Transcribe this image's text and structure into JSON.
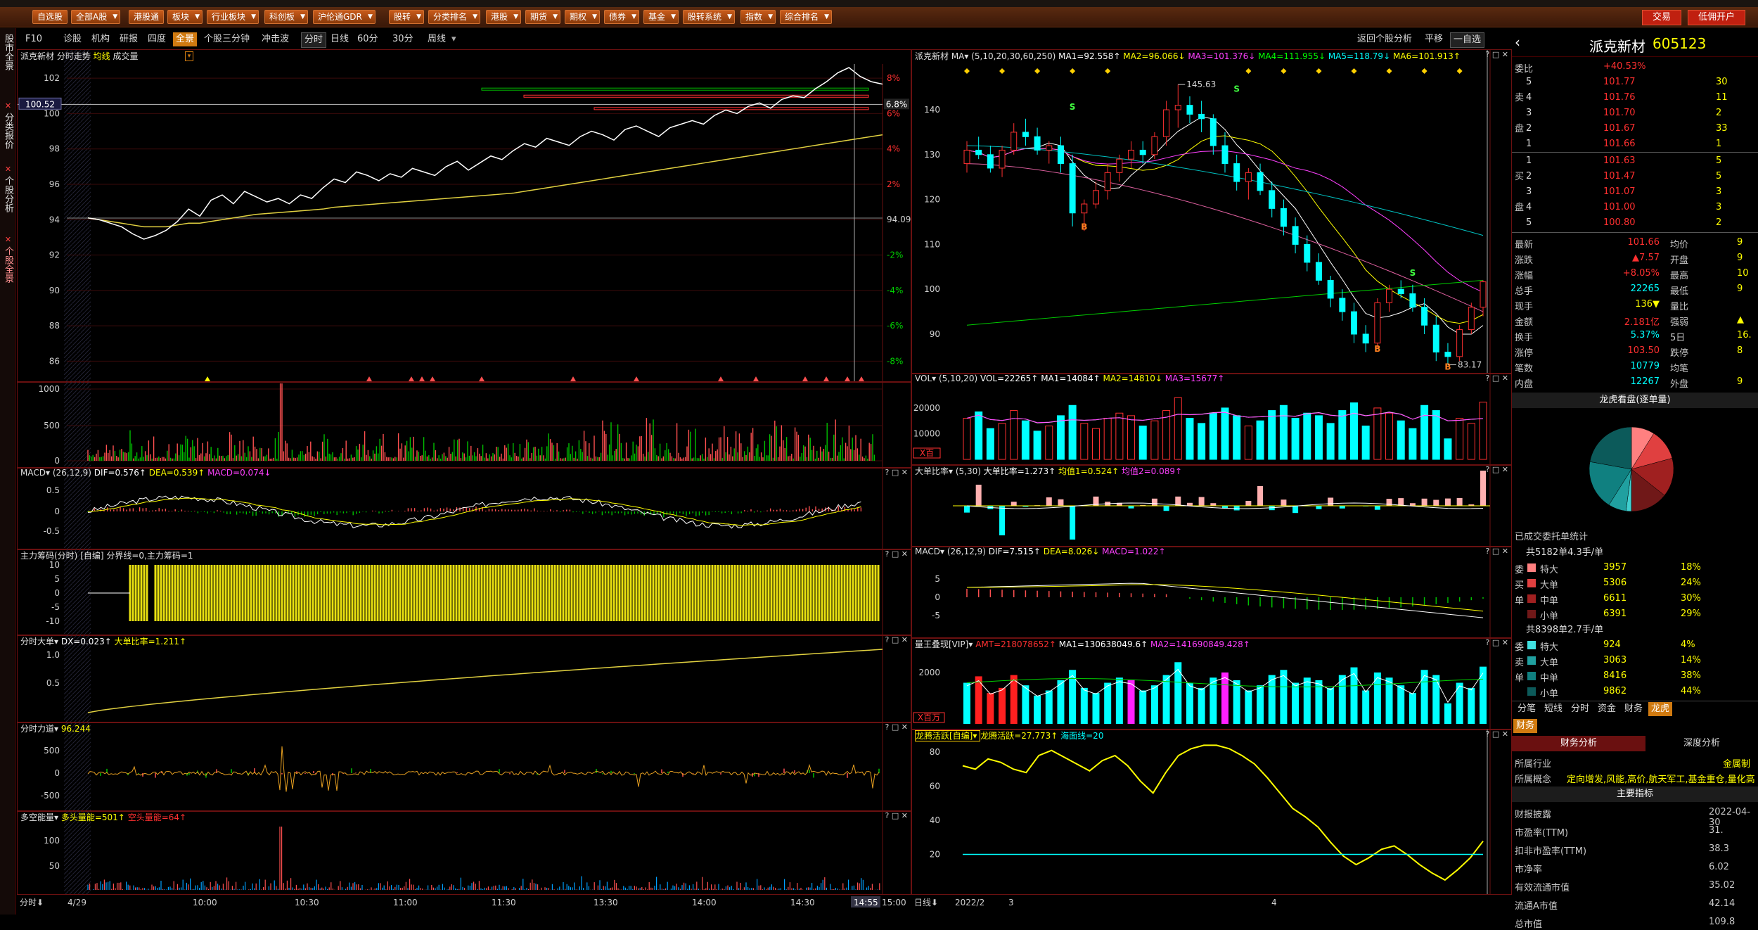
{
  "menubar": {
    "buttons": [
      "自选股",
      "全部A股",
      "港股通",
      "板块",
      "行业板块",
      "科创板",
      "沪伦通GDR",
      "股转",
      "分类排名",
      "港股",
      "期货",
      "期权",
      "债券",
      "基金",
      "股转系统",
      "指数",
      "综合排名"
    ],
    "right_buttons": [
      "交易",
      "低佣开户"
    ]
  },
  "leftrail": {
    "tabs": [
      "股市全景",
      "分类报价",
      "个股分析",
      "个股全景"
    ]
  },
  "tabbar": {
    "tabs": [
      "F10",
      "诊股",
      "机构",
      "研报",
      "四度",
      "全景",
      "个股三分钟",
      "冲击波"
    ],
    "periods": [
      "分时",
      "日线",
      "60分",
      "30分",
      "周线"
    ],
    "right_tabs": [
      "返回个股分析",
      "平移",
      "一自选"
    ]
  },
  "intraday": {
    "title_stock": "派克新材",
    "title_label": "分时走势",
    "title_avg": "均线",
    "title_vol": "成交量",
    "price_ticks": [
      "102",
      "100",
      "98",
      "96",
      "94",
      "92",
      "90",
      "88",
      "86"
    ],
    "pct_ticks": [
      "8%",
      "6%",
      "4%",
      "2%",
      "",
      "-2%",
      "-4%",
      "-6%",
      "-8%"
    ],
    "current_price_label": "100.52",
    "current_pct_label": "6.8%",
    "prev_close_label": "94.09",
    "time_labels": [
      "4/29",
      "10:00",
      "10:30",
      "11:00",
      "11:30",
      "13:30",
      "14:00",
      "14:30",
      "14:55",
      "15:00"
    ],
    "time_toggle": "分时",
    "vol_ticks": [
      "1000",
      "500",
      "0"
    ]
  },
  "macd1": {
    "name": "MACD",
    "params": "(26,12,9)",
    "dif": "DIF=0.576",
    "dea": "DEA=0.539",
    "macd": "MACD=0.074"
  },
  "chips": {
    "name": "主力筹码(分时)",
    "flag": "[自编]",
    "divider": "分界线=0,主力筹码=1",
    "ticks": [
      "10",
      "5",
      "0",
      "-5",
      "-10"
    ]
  },
  "bigorder": {
    "name": "分时大单",
    "dx": "DX=0.023",
    "ratio": "大单比率=1.211",
    "ticks": [
      "1.0",
      "0.5"
    ]
  },
  "force": {
    "name": "分时力道",
    "value": "96.244",
    "ticks": [
      "500",
      "0",
      "-500"
    ]
  },
  "bullbear": {
    "name": "多空能量",
    "bull": "多头量能=501",
    "bear": "空头量能=64",
    "ticks": [
      "100",
      "50"
    ]
  },
  "daily": {
    "stock": "派克新材",
    "ma_name": "MA",
    "ma_params": "(5,10,20,30,60,250)",
    "ma_values": [
      "MA1=92.558",
      "MA2=96.066",
      "MA3=101.376",
      "MA4=111.955",
      "MA5=118.79",
      "MA6=101.913"
    ],
    "price_ticks": [
      "140",
      "130",
      "120",
      "110",
      "100",
      "90"
    ],
    "high_label": "145.63",
    "low_label": "83.17",
    "time_labels": [
      "日线",
      "2022/2",
      "3",
      "4"
    ],
    "buy_marks": [
      "B",
      "B",
      "B"
    ],
    "sell_marks": [
      "S",
      "S",
      "S"
    ]
  },
  "vol": {
    "name": "VOL",
    "params": "(5,10,20)",
    "vol": "VOL=22265",
    "ma1": "MA1=14084",
    "ma2": "MA2=14810",
    "ma3": "MA3=15677",
    "ticks": [
      "20000",
      "10000"
    ],
    "unit": "X百"
  },
  "bigratio": {
    "name": "大单比率",
    "params": "(5,30)",
    "value": "大单比率=1.273",
    "avg1": "均值1=0.524",
    "avg2": "均值2=0.089"
  },
  "macd2": {
    "name": "MACD",
    "params": "(26,12,9)",
    "dif": "DIF=7.515",
    "dea": "DEA=8.026",
    "macd": "MACD=1.022",
    "ticks": [
      "5",
      "0",
      "-5"
    ]
  },
  "amount": {
    "name": "量王叠现[VIP]",
    "amt": "AMT=218078652",
    "ma1": "MA1=130638049.6",
    "ma2": "MA2=141690849.428",
    "ticks": [
      "2000"
    ],
    "unit": "X百万"
  },
  "dragon": {
    "name": "龙腾活跃[自编]",
    "value": "龙腾活跃=27.773",
    "sea": "海面线=20",
    "ticks": [
      "80",
      "60",
      "40",
      "20"
    ]
  },
  "quote": {
    "name": "派克新材",
    "code": "605123",
    "wb_label": "委比",
    "wb_value": "+40.53%",
    "asks": [
      {
        "label": "5",
        "price": "101.77",
        "vol": "30"
      },
      {
        "label": "4",
        "price": "101.76",
        "vol": "11"
      },
      {
        "label": "3",
        "price": "101.70",
        "vol": "2"
      },
      {
        "label": "2",
        "price": "101.67",
        "vol": "33"
      },
      {
        "label": "1",
        "price": "101.66",
        "vol": "1"
      }
    ],
    "bids": [
      {
        "label": "1",
        "price": "101.63",
        "vol": "5"
      },
      {
        "label": "2",
        "price": "101.47",
        "vol": "5"
      },
      {
        "label": "3",
        "price": "101.07",
        "vol": "3"
      },
      {
        "label": "4",
        "price": "101.00",
        "vol": "3"
      },
      {
        "label": "5",
        "price": "100.80",
        "vol": "2"
      }
    ],
    "side_sell": [
      "卖",
      "盘"
    ],
    "side_buy": [
      "买",
      "盘"
    ],
    "stats": [
      {
        "l": "最新",
        "v": "101.66",
        "l2": "均价",
        "v2": "9"
      },
      {
        "l": "涨跌",
        "v": "▲7.57",
        "l2": "开盘",
        "v2": "9"
      },
      {
        "l": "涨幅",
        "v": "+8.05%",
        "l2": "最高",
        "v2": "10"
      },
      {
        "l": "总手",
        "v": "22265",
        "l2": "最低",
        "v2": "9"
      },
      {
        "l": "现手",
        "v": "136▼",
        "l2": "量比",
        "v2": ""
      },
      {
        "l": "金额",
        "v": "2.181亿",
        "l2": "强弱",
        "v2": "▲"
      },
      {
        "l": "换手",
        "v": "5.37%",
        "l2": "5日",
        "v2": "16."
      },
      {
        "l": "涨停",
        "v": "103.50",
        "l2": "跌停",
        "v2": "8"
      },
      {
        "l": "笔数",
        "v": "10779",
        "l2": "均笔",
        "v2": ""
      },
      {
        "l": "内盘",
        "v": "12267",
        "l2": "外盘",
        "v2": "9"
      }
    ],
    "pie_title": "龙虎看盘(逐单量)",
    "order_stats_title": "已成交委托单统计",
    "buy_total": "共5182单4.3手/单",
    "buy_side": [
      "委",
      "买",
      "单"
    ],
    "buy_rows": [
      {
        "n": "特大",
        "v": "3957",
        "p": "18%"
      },
      {
        "n": "大单",
        "v": "5306",
        "p": "24%"
      },
      {
        "n": "中单",
        "v": "6611",
        "p": "30%"
      },
      {
        "n": "小单",
        "v": "6391",
        "p": "29%"
      }
    ],
    "sell_total": "共8398单2.7手/单",
    "sell_side": [
      "委",
      "卖",
      "单"
    ],
    "sell_rows": [
      {
        "n": "特大",
        "v": "924",
        "p": "4%"
      },
      {
        "n": "大单",
        "v": "3063",
        "p": "14%"
      },
      {
        "n": "中单",
        "v": "8416",
        "p": "38%"
      },
      {
        "n": "小单",
        "v": "9862",
        "p": "44%"
      }
    ],
    "bottom_tabs": [
      "分笔",
      "短线",
      "分时",
      "资金",
      "财务",
      "龙虎"
    ],
    "fin_tab": "财务",
    "fin_tabs": [
      "财务分析",
      "深度分析"
    ],
    "industry_label": "所属行业",
    "industry_value": "金属制",
    "concept_label": "所属概念",
    "concept_value": "定向增发,风能,高价,航天军工,基金重仓,量化高",
    "main_indicators": "主要指标",
    "fin_rows": [
      {
        "l": "财报披露",
        "v": "2022-04-30"
      },
      {
        "l": "市盈率(TTM)",
        "v": "31."
      },
      {
        "l": "扣非市盈率(TTM)",
        "v": "38.3"
      },
      {
        "l": "市净率",
        "v": "6.02"
      },
      {
        "l": "有效流通市值",
        "v": "35.02"
      },
      {
        "l": "流通A市值",
        "v": "42.14"
      },
      {
        "l": "总市值",
        "v": "109.8"
      }
    ]
  },
  "chart_data": [
    {
      "type": "line",
      "title": "分时走势",
      "prev_close": 94.09,
      "ylim": [
        85.5,
        102.8
      ],
      "series": [
        {
          "name": "分时",
          "values": [
            94.1,
            94.0,
            93.8,
            93.6,
            93.2,
            92.9,
            93.1,
            93.4,
            93.9,
            94.6,
            94.2,
            95.1,
            95.4,
            94.9,
            95.6,
            95.3,
            95.0,
            95.2,
            94.9,
            95.4,
            95.2,
            95.8,
            96.3,
            96.1,
            96.7,
            96.5,
            96.2,
            96.6,
            96.4,
            96.9,
            96.7,
            96.5,
            97.0,
            97.3,
            96.8,
            97.2,
            97.6,
            97.4,
            97.9,
            98.3,
            98.1,
            98.6,
            98.4,
            98.2,
            98.7,
            99.0,
            98.8,
            98.5,
            99.1,
            99.3,
            99.0,
            98.7,
            99.2,
            99.4,
            99.6,
            99.4,
            99.9,
            100.2,
            100.0,
            100.4,
            100.6,
            100.3,
            100.8,
            101.0,
            100.9,
            101.4,
            101.8,
            102.3,
            102.6,
            102.1,
            101.8,
            101.66
          ]
        },
        {
          "name": "均线",
          "values": [
            94.1,
            94.0,
            93.9,
            93.8,
            93.7,
            93.6,
            93.6,
            93.6,
            93.7,
            93.8,
            93.8,
            93.9,
            94.0,
            94.1,
            94.2,
            94.3,
            94.35,
            94.4,
            94.45,
            94.5,
            94.55,
            94.6,
            94.7,
            94.75,
            94.8,
            94.85,
            94.9,
            94.95,
            95.0,
            95.05,
            95.1,
            95.15,
            95.2,
            95.25,
            95.3,
            95.35,
            95.4,
            95.45,
            95.5,
            95.6,
            95.7,
            95.8,
            95.9,
            96.0,
            96.1,
            96.2,
            96.3,
            96.4,
            96.5,
            96.6,
            96.7,
            96.8,
            96.9,
            97.0,
            97.1,
            97.2,
            97.3,
            97.4,
            97.5,
            97.6,
            97.7,
            97.8,
            97.9,
            98.0,
            98.1,
            98.2,
            98.3,
            98.4,
            98.5,
            98.6,
            98.7,
            98.8
          ]
        }
      ]
    },
    {
      "type": "candlestick",
      "title": "日线",
      "ylim": [
        82,
        148
      ],
      "ohlc": [
        [
          128,
          133,
          126,
          131
        ],
        [
          131,
          134,
          129,
          130
        ],
        [
          130,
          132,
          126,
          127
        ],
        [
          127,
          132,
          125,
          131
        ],
        [
          131,
          137,
          130,
          135
        ],
        [
          135,
          138,
          132,
          134
        ],
        [
          134,
          136,
          130,
          131
        ],
        [
          131,
          133,
          128,
          132
        ],
        [
          132,
          134,
          126,
          128
        ],
        [
          128,
          130,
          114,
          117
        ],
        [
          117,
          120,
          113,
          119
        ],
        [
          119,
          124,
          118,
          122
        ],
        [
          122,
          128,
          120,
          126
        ],
        [
          126,
          130,
          124,
          129
        ],
        [
          129,
          133,
          127,
          131
        ],
        [
          131,
          133,
          128,
          130
        ],
        [
          130,
          135,
          129,
          134
        ],
        [
          134,
          142,
          132,
          140
        ],
        [
          140,
          145.63,
          136,
          141
        ],
        [
          141,
          143,
          137,
          139
        ],
        [
          139,
          142,
          135,
          138
        ],
        [
          138,
          139,
          130,
          132
        ],
        [
          132,
          135,
          126,
          128
        ],
        [
          128,
          130,
          122,
          124
        ],
        [
          124,
          127,
          120,
          126
        ],
        [
          126,
          128,
          121,
          122
        ],
        [
          122,
          124,
          116,
          118
        ],
        [
          118,
          120,
          112,
          114
        ],
        [
          114,
          116,
          108,
          110
        ],
        [
          110,
          112,
          104,
          106
        ],
        [
          106,
          108,
          101,
          102
        ],
        [
          102,
          103,
          96,
          98
        ],
        [
          98,
          100,
          93,
          95
        ],
        [
          95,
          97,
          88,
          90
        ],
        [
          90,
          92,
          86,
          88
        ],
        [
          88,
          98,
          87,
          97
        ],
        [
          97,
          101,
          95,
          100
        ],
        [
          100,
          102,
          98,
          99
        ],
        [
          99,
          101,
          95,
          96
        ],
        [
          96,
          98,
          90,
          92
        ],
        [
          92,
          94,
          84,
          86
        ],
        [
          86,
          88,
          83.17,
          85
        ],
        [
          85,
          92,
          84,
          91
        ],
        [
          91,
          97,
          90,
          96
        ],
        [
          96,
          102,
          94,
          101.66
        ]
      ],
      "volumes": [
        16000,
        18500,
        12000,
        14000,
        19000,
        15000,
        11000,
        13000,
        17000,
        21000,
        14000,
        12000,
        16000,
        18000,
        17000,
        13000,
        15000,
        19000,
        24000,
        16000,
        14000,
        18000,
        20000,
        17000,
        13000,
        15000,
        19000,
        21000,
        16000,
        18000,
        17000,
        14000,
        19000,
        22000,
        13000,
        20000,
        18000,
        15000,
        12000,
        21000,
        19000,
        8000,
        16000,
        14000,
        22265
      ]
    },
    {
      "type": "line",
      "title": "龙腾活跃",
      "ylim": [
        0,
        85
      ],
      "series": [
        {
          "name": "龙腾活跃",
          "values": [
            72,
            70,
            76,
            74,
            70,
            68,
            78,
            81,
            77,
            73,
            69,
            75,
            78,
            72,
            63,
            56,
            68,
            78,
            82,
            84,
            84,
            82,
            78,
            73,
            65,
            56,
            47,
            42,
            36,
            27,
            19,
            14,
            18,
            23,
            25,
            20,
            14,
            9,
            5,
            11,
            18,
            27.773
          ]
        },
        {
          "name": "海面线",
          "values": [
            20,
            20,
            20,
            20,
            20,
            20,
            20,
            20,
            20,
            20,
            20,
            20,
            20,
            20,
            20,
            20,
            20,
            20,
            20,
            20,
            20,
            20,
            20,
            20,
            20,
            20,
            20,
            20,
            20,
            20,
            20,
            20,
            20,
            20,
            20,
            20,
            20,
            20,
            20,
            20,
            20,
            20
          ]
        }
      ]
    },
    {
      "type": "pie",
      "title": "龙虎看盘(逐单量)",
      "categories": [
        "买特大",
        "买大单",
        "买中单",
        "买小单",
        "卖特大",
        "卖大单",
        "卖中单",
        "卖小单"
      ],
      "values": [
        3957,
        5306,
        6611,
        6391,
        924,
        3063,
        8416,
        9862
      ]
    }
  ],
  "colors": {
    "up": "#ff3030",
    "down": "#00ffff",
    "green": "#00c000",
    "yellow": "#ffff00",
    "grid": "#6a1010",
    "accent": "#d07a10"
  }
}
